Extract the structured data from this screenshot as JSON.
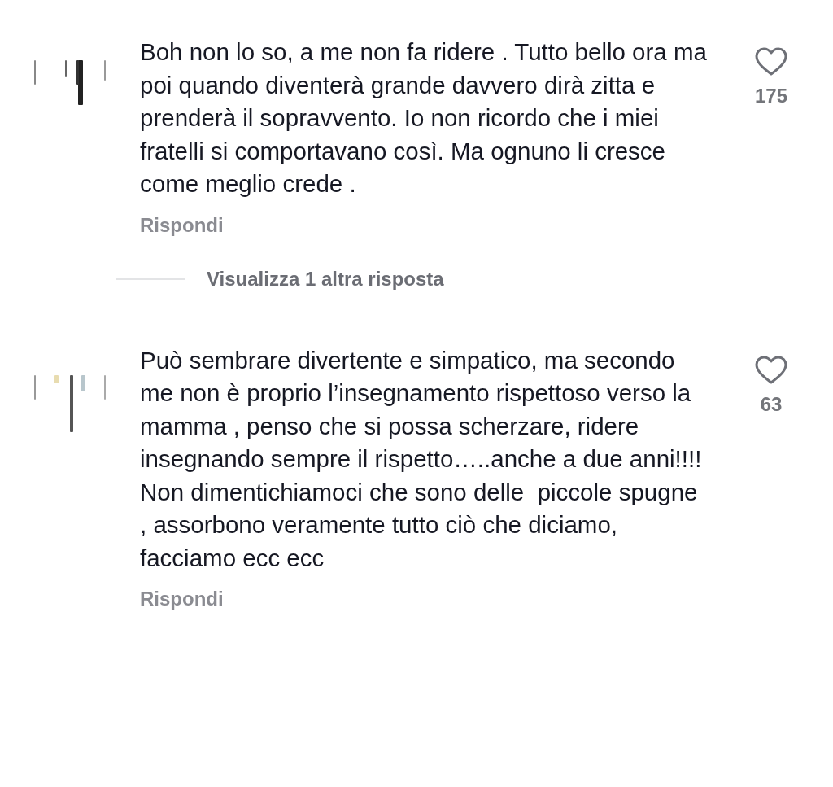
{
  "comments": [
    {
      "text": "Boh non lo so, a me non fa ridere . Tutto bello ora ma poi quando diventerà grande davvero dirà zitta e prenderà il sopravvento. Io non ricordo che i miei fratelli si comportavano così. Ma ognuno li cresce come meglio crede .",
      "likes": "175",
      "liked": false,
      "reply_label": "Rispondi",
      "more_replies": "Visualizza 1 altra risposta"
    },
    {
      "text": "Può sembrare divertente e simpatico, ma secondo me non è proprio l’insegnamento rispettoso verso la mamma , penso che si possa scherzare, ridere insegnando sempre il rispetto…..anche a due anni!!!! Non dimentichiamoci che sono delle  piccole spugne , assorbono veramente tutto ciò che diciamo, facciamo ecc ecc",
      "likes": "63",
      "liked": false,
      "reply_label": "Rispondi"
    }
  ]
}
